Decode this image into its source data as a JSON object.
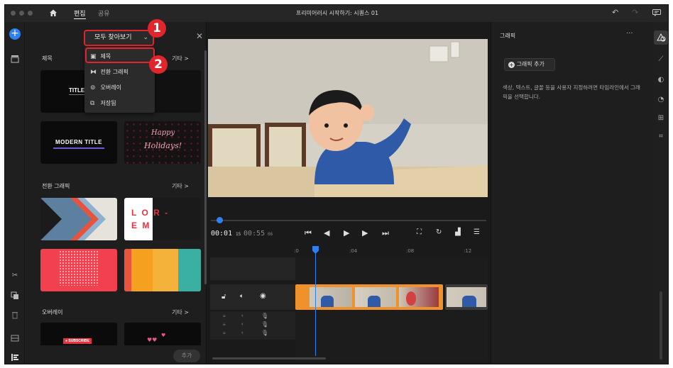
{
  "titlebar": {
    "tabs": [
      {
        "label": "편집",
        "active": true
      },
      {
        "label": "공유",
        "active": false
      }
    ],
    "title": "프리미어러시 시작하기: 시퀀스 01"
  },
  "graphics_panel": {
    "filter_label": "모두 찾아보기",
    "menu_items": [
      {
        "label": "제목",
        "icon": "title-icon"
      },
      {
        "label": "전환 그래픽",
        "icon": "transition-icon"
      },
      {
        "label": "오버레이",
        "icon": "overlay-icon"
      },
      {
        "label": "저장됨",
        "icon": "saved-icon"
      }
    ],
    "sections": [
      {
        "title": "제목",
        "more": "기타 >"
      },
      {
        "title": "전환 그래픽",
        "more": "기타 >"
      },
      {
        "title": "오버레이",
        "more": "기타 >"
      }
    ],
    "thumbs": {
      "title_thumb": "TITLE",
      "modern_title": "MODERN TITLE",
      "happy_holidays": [
        "Happy",
        "Holidays!"
      ],
      "lorem": [
        "L O R -",
        "E M"
      ],
      "subscribe": "● SUBSCRIBE"
    },
    "add_button": "추가",
    "annotations": [
      "1",
      "2"
    ]
  },
  "timeline": {
    "current_time": "00:01",
    "current_frames": "15",
    "duration_time": "00:55",
    "duration_frames": "06",
    "ruler": [
      ":0",
      ":04",
      ":08",
      ":12"
    ]
  },
  "right_panel": {
    "title": "그래픽",
    "add_graphic": "그래픽 추가",
    "description": "색상, 텍스트, 글꼴 등을 사용자 지정하려면 타임라인에서 그래픽을 선택합니다."
  },
  "colors": {
    "accent": "#2f7ff5",
    "annotation_red": "#e0262c",
    "clip_orange": "#f0922c"
  }
}
